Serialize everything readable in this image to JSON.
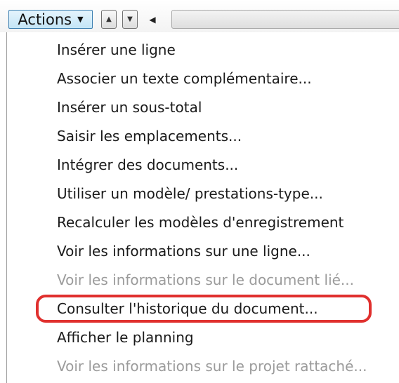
{
  "toolbar": {
    "actions_label": "Actions",
    "actions_caret_icon": "dropdown-arrow-icon",
    "up_icon": "triangle-up-icon",
    "down_icon": "triangle-down-icon",
    "left_icon": "arrow-left-icon"
  },
  "menu": {
    "items": [
      {
        "label": "Insérer une ligne",
        "enabled": true
      },
      {
        "label": "Associer un texte complémentaire...",
        "enabled": true
      },
      {
        "label": "Insérer un sous-total",
        "enabled": true
      },
      {
        "label": "Saisir les emplacements...",
        "enabled": true
      },
      {
        "label": "Intégrer des documents...",
        "enabled": true
      },
      {
        "label": "Utiliser un modèle/ prestations-type...",
        "enabled": true
      },
      {
        "label": "Recalculer les modèles d'enregistrement",
        "enabled": true
      },
      {
        "label": "Voir les informations sur une ligne...",
        "enabled": true
      },
      {
        "label": "Voir les informations sur le document lié...",
        "enabled": false
      },
      {
        "label": "Consulter l'historique du document...",
        "enabled": true,
        "highlighted": true
      },
      {
        "label": "Afficher le planning",
        "enabled": true
      },
      {
        "label": "Voir les informations sur le projet rattaché...",
        "enabled": false
      }
    ]
  },
  "colors": {
    "highlight": "#e0302e",
    "disabled_text": "#9b9b9b",
    "button_border": "#3c7fb1"
  }
}
